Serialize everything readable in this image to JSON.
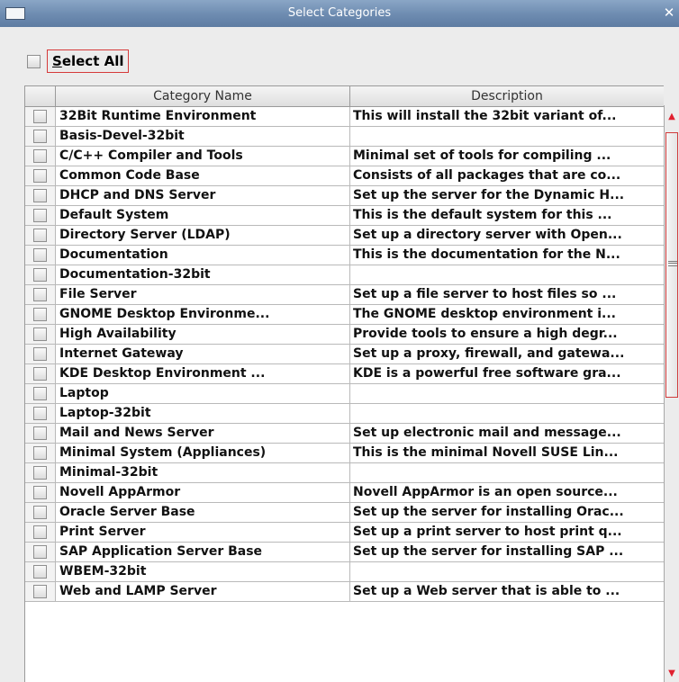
{
  "window": {
    "title": "Select Categories",
    "close_glyph": "✕"
  },
  "select_all": {
    "label_mnemonic": "S",
    "label_rest": "elect All",
    "checked": false
  },
  "table": {
    "columns": [
      "",
      "Category Name",
      "Description"
    ],
    "rows": [
      {
        "name": "32Bit Runtime Environment",
        "description": "This will install the 32bit variant of...",
        "checked": false
      },
      {
        "name": "Basis-Devel-32bit",
        "description": "",
        "checked": false
      },
      {
        "name": "C/C++ Compiler and Tools",
        "description": "Minimal set of tools for compiling ...",
        "checked": false
      },
      {
        "name": "Common Code Base",
        "description": "Consists of all packages that are co...",
        "checked": false
      },
      {
        "name": "DHCP and DNS Server",
        "description": "Set up the server for the Dynamic H...",
        "checked": false
      },
      {
        "name": "Default System",
        "description": "This is the default system for this ...",
        "checked": false
      },
      {
        "name": "Directory Server (LDAP)",
        "description": "Set up a directory server with Open...",
        "checked": false
      },
      {
        "name": "Documentation",
        "description": "This is the documentation for the N...",
        "checked": false
      },
      {
        "name": "Documentation-32bit",
        "description": "",
        "checked": false
      },
      {
        "name": "File Server",
        "description": "Set up a file server to host files so ...",
        "checked": false
      },
      {
        "name": "GNOME Desktop Environme...",
        "description": "The GNOME desktop environment i...",
        "checked": false
      },
      {
        "name": "High Availability",
        "description": "Provide tools to ensure a high degr...",
        "checked": false
      },
      {
        "name": "Internet Gateway",
        "description": "Set up a proxy, firewall, and gatewa...",
        "checked": false
      },
      {
        "name": "KDE Desktop Environment ...",
        "description": "KDE is a powerful free software gra...",
        "checked": false
      },
      {
        "name": "Laptop",
        "description": "",
        "checked": false
      },
      {
        "name": "Laptop-32bit",
        "description": "",
        "checked": false
      },
      {
        "name": "Mail and News Server",
        "description": "Set up electronic mail and message...",
        "checked": false
      },
      {
        "name": "Minimal System (Appliances)",
        "description": "This is the minimal Novell SUSE Lin...",
        "checked": false
      },
      {
        "name": "Minimal-32bit",
        "description": "",
        "checked": false
      },
      {
        "name": "Novell AppArmor",
        "description": "Novell AppArmor is an open source...",
        "checked": false
      },
      {
        "name": "Oracle Server Base",
        "description": "Set up the server for installing Orac...",
        "checked": false
      },
      {
        "name": "Print Server",
        "description": "Set up a print server to host print q...",
        "checked": false
      },
      {
        "name": "SAP Application Server Base",
        "description": "Set up the server for installing SAP ...",
        "checked": false
      },
      {
        "name": "WBEM-32bit",
        "description": "",
        "checked": false
      },
      {
        "name": "Web and LAMP Server",
        "description": "Set up a Web server that is able to ...",
        "checked": false
      }
    ]
  },
  "icons": {
    "window_menu": "window-menu-icon",
    "close": "close-icon",
    "scroll_up": "scroll-up-arrow-icon",
    "scroll_down": "scroll-down-arrow-icon"
  }
}
